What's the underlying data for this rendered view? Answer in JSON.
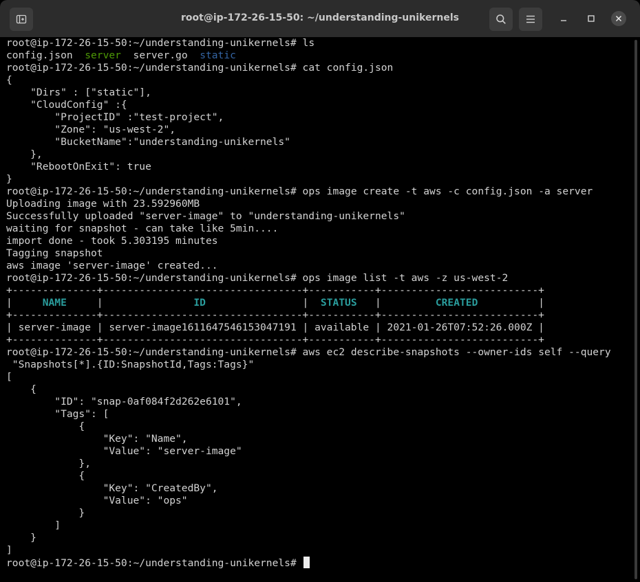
{
  "window": {
    "title": "root@ip-172-26-15-50: ~/understanding-unikernels",
    "buttons": [
      "new-tab-icon",
      "search-icon",
      "menu-icon",
      "minimize-icon",
      "maximize-icon",
      "close-icon"
    ]
  },
  "prompt": "root@ip-172-26-15-50:~/understanding-unikernels# ",
  "colors": {
    "directory": "#4e9a06",
    "folder": "#3465a4",
    "table_header": "#2a9d9d",
    "text": "#d3d3d3"
  },
  "lines": {
    "cmd_ls": "ls",
    "ls_config": "config.json",
    "ls_server": "server",
    "ls_servergo": "server.go",
    "ls_static": "static",
    "cmd_cat": "cat config.json",
    "c1": "{",
    "c2": "    \"Dirs\" : [\"static\"],",
    "c3": "    \"CloudConfig\" :{",
    "c4": "        \"ProjectID\" :\"test-project\",",
    "c5": "        \"Zone\": \"us-west-2\",",
    "c6": "        \"BucketName\":\"understanding-unikernels\"",
    "c7": "    },",
    "c8": "    \"RebootOnExit\": true",
    "c9": "}",
    "cmd_create": "ops image create -t aws -c config.json -a server",
    "o1": "Uploading image with 23.592960MB",
    "o2": "Successfully uploaded \"server-image\" to \"understanding-unikernels\"",
    "o3": "waiting for snapshot - can take like 5min....",
    "o4": "import done - took 5.303195 minutes",
    "o5": "Tagging snapshot",
    "o6": "aws image 'server-image' created...",
    "cmd_list": "ops image list -t aws -z us-west-2",
    "t_border": "+--------------+---------------------------------+-----------+--------------------------+",
    "t_pipe_1": "|     ",
    "t_name": "NAME",
    "t_pipe_2": "     |               ",
    "t_id": "ID",
    "t_pipe_3": "                |  ",
    "t_status": "STATUS",
    "t_pipe_4": "   |         ",
    "t_created": "CREATED",
    "t_pipe_5": "          |",
    "t_row": "| server-image | server-image1611647546153047191 | available | 2021-01-26T07:52:26.000Z |",
    "cmd_aws": "aws ec2 describe-snapshots --owner-ids self --query",
    "cmd_aws_cont": " \"Snapshots[*].{ID:SnapshotId,Tags:Tags}\"",
    "j1": "[",
    "j2": "    {",
    "j3": "        \"ID\": \"snap-0af084f2d262e6101\",",
    "j4": "        \"Tags\": [",
    "j5": "            {",
    "j6": "                \"Key\": \"Name\",",
    "j7": "                \"Value\": \"server-image\"",
    "j8": "            },",
    "j9": "            {",
    "j10": "                \"Key\": \"CreatedBy\",",
    "j11": "                \"Value\": \"ops\"",
    "j12": "            }",
    "j13": "        ]",
    "j14": "    }",
    "j15": "]"
  }
}
